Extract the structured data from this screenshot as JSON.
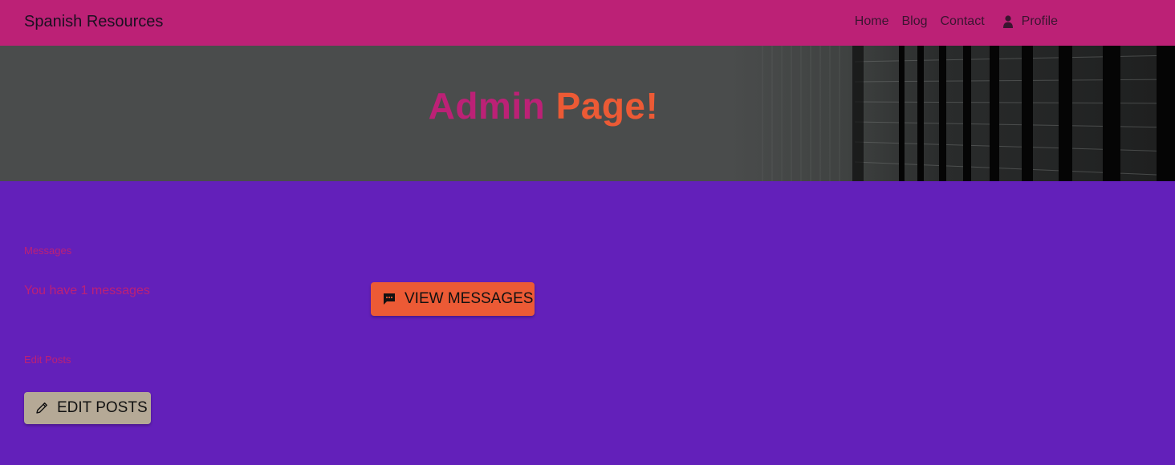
{
  "navbar": {
    "brand": "Spanish Resources",
    "links": [
      {
        "label": "Home"
      },
      {
        "label": "Blog"
      },
      {
        "label": "Contact"
      },
      {
        "label": "Profile",
        "icon": "user-icon"
      }
    ],
    "background": "#bc2176"
  },
  "hero": {
    "title_word1": "Admin",
    "title_word2": "Page!",
    "title_word1_color": "#bc2176",
    "title_word2_color": "#ec5a35"
  },
  "messages": {
    "section_label": "Messages",
    "summary": "You have 1 messages",
    "button_label": "VIEW MESSAGES",
    "button_icon": "chat-icon",
    "button_color": "#ec5a35"
  },
  "edit_posts": {
    "section_label": "Edit Posts",
    "button_label": "EDIT POSTS",
    "button_icon": "pencil-icon",
    "button_color": "#b5a996"
  },
  "colors": {
    "page_background": "#6320ba",
    "accent": "#bc2176"
  }
}
